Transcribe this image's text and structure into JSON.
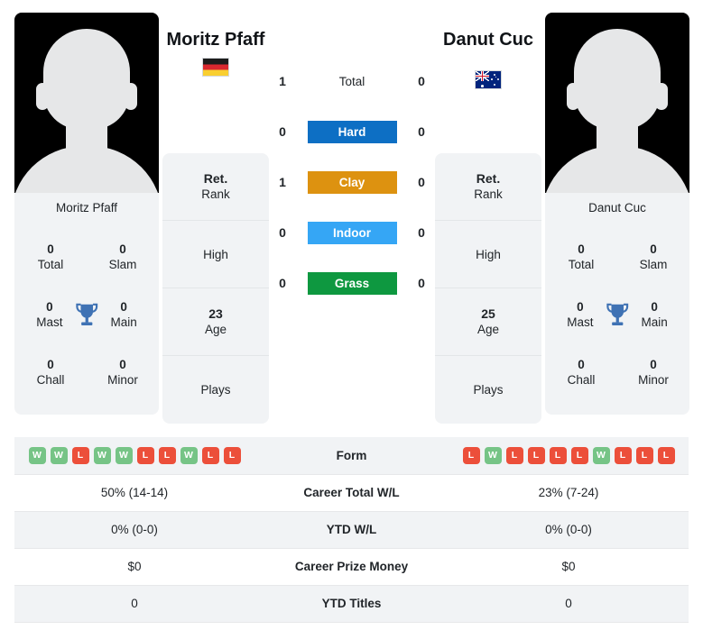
{
  "players": {
    "left": {
      "name": "Moritz Pfaff",
      "flag": "de",
      "flag_title": "Germany",
      "avatar_name": "Moritz Pfaff",
      "rank_value": "Ret.",
      "rank_label": "Rank",
      "high_value": "",
      "high_label": "High",
      "age_value": "23",
      "age_label": "Age",
      "plays_value": "",
      "plays_label": "Plays",
      "titles": {
        "total": {
          "num": "0",
          "label": "Total"
        },
        "slam": {
          "num": "0",
          "label": "Slam"
        },
        "mast": {
          "num": "0",
          "label": "Mast"
        },
        "main": {
          "num": "0",
          "label": "Main"
        },
        "chall": {
          "num": "0",
          "label": "Chall"
        },
        "minor": {
          "num": "0",
          "label": "Minor"
        }
      },
      "form": [
        "W",
        "W",
        "L",
        "W",
        "W",
        "L",
        "L",
        "W",
        "L",
        "L"
      ],
      "career_wl": "50% (14-14)",
      "ytd_wl": "0% (0-0)",
      "prize_money": "$0",
      "ytd_titles": "0"
    },
    "right": {
      "name": "Danut Cuc",
      "flag": "au",
      "flag_title": "Australia",
      "avatar_name": "Danut Cuc",
      "rank_value": "Ret.",
      "rank_label": "Rank",
      "high_value": "",
      "high_label": "High",
      "age_value": "25",
      "age_label": "Age",
      "plays_value": "",
      "plays_label": "Plays",
      "titles": {
        "total": {
          "num": "0",
          "label": "Total"
        },
        "slam": {
          "num": "0",
          "label": "Slam"
        },
        "mast": {
          "num": "0",
          "label": "Mast"
        },
        "main": {
          "num": "0",
          "label": "Main"
        },
        "chall": {
          "num": "0",
          "label": "Chall"
        },
        "minor": {
          "num": "0",
          "label": "Minor"
        }
      },
      "form": [
        "L",
        "W",
        "L",
        "L",
        "L",
        "L",
        "W",
        "L",
        "L",
        "L"
      ],
      "career_wl": "23% (7-24)",
      "ytd_wl": "0% (0-0)",
      "prize_money": "$0",
      "ytd_titles": "0"
    }
  },
  "h2h": {
    "rows": [
      {
        "label": "Total",
        "left": "1",
        "right": "0",
        "color": "",
        "plain": true
      },
      {
        "label": "Hard",
        "left": "0",
        "right": "0",
        "color": "#0d6fc4",
        "plain": false
      },
      {
        "label": "Clay",
        "left": "1",
        "right": "0",
        "color": "#dd9210",
        "plain": false
      },
      {
        "label": "Indoor",
        "left": "0",
        "right": "0",
        "color": "#35a6f5",
        "plain": false
      },
      {
        "label": "Grass",
        "left": "0",
        "right": "0",
        "color": "#0e9840",
        "plain": false
      }
    ]
  },
  "table": {
    "rows": [
      {
        "label": "Form",
        "type": "form"
      },
      {
        "label": "Career Total W/L",
        "type": "text",
        "key": "career_wl"
      },
      {
        "label": "YTD W/L",
        "type": "text",
        "key": "ytd_wl"
      },
      {
        "label": "Career Prize Money",
        "type": "text",
        "key": "prize_money"
      },
      {
        "label": "YTD Titles",
        "type": "text",
        "key": "ytd_titles"
      }
    ]
  },
  "colors": {
    "win": "#76c486",
    "loss": "#ec4f3a",
    "card_bg": "#f1f3f5",
    "trophy": "#3f72b4"
  },
  "icons": {
    "trophy": "trophy-icon",
    "avatar": "avatar-silhouette-icon"
  }
}
